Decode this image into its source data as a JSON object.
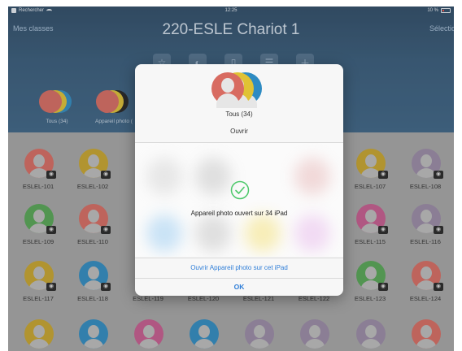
{
  "status_bar": {
    "carrier": "Rechercher",
    "time": "12:25",
    "battery": "10 %"
  },
  "nav": {
    "left_label": "Mes classes",
    "title": "220-ESLE Chariot 1",
    "right_label": "Sélectionner"
  },
  "toolbar": {
    "icons": [
      "star-icon",
      "compass-icon",
      "lock-icon",
      "document-icon",
      "plus-icon"
    ]
  },
  "groups": [
    {
      "label": "Tous (34)"
    },
    {
      "label": "Appareil photo ("
    }
  ],
  "students": [
    {
      "name": "ESLEL-101",
      "color": "#d86b61"
    },
    {
      "name": "ESLEL-102",
      "color": "#c9a52b"
    },
    {
      "name": "ESLEL-107",
      "color": "#c9a52b"
    },
    {
      "name": "ESLEL-108",
      "color": "#9a8aa6"
    },
    {
      "name": "ESLEL-109",
      "color": "#55a654"
    },
    {
      "name": "ESLEL-110",
      "color": "#d86b61"
    },
    {
      "name": "ESLEL-115",
      "color": "#c75b8f"
    },
    {
      "name": "ESLEL-116",
      "color": "#9a8aa6"
    },
    {
      "name": "ESLEL-117",
      "color": "#c9a52b"
    },
    {
      "name": "ESLEL-118",
      "color": "#2e8bc2"
    },
    {
      "name": "ESLEL-119",
      "color": ""
    },
    {
      "name": "ESLEL-120",
      "color": ""
    },
    {
      "name": "ESLEL-121",
      "color": ""
    },
    {
      "name": "ESLEL-122",
      "color": ""
    },
    {
      "name": "ESLEL-123",
      "color": "#55a654"
    },
    {
      "name": "ESLEL-124",
      "color": "#d86b61"
    }
  ],
  "modal": {
    "title": "Tous (34)",
    "action": "Ouvrir",
    "success_message": "Appareil photo ouvert sur 34 iPad",
    "open_here_button": "Ouvrir Appareil photo sur cet iPad",
    "ok_button": "OK"
  },
  "colors": {
    "accent": "#2f7ed8",
    "success": "#4cc86a",
    "avatar_red": "#d86b61",
    "avatar_yellow": "#e0c234",
    "avatar_blue": "#2e8bc2"
  }
}
